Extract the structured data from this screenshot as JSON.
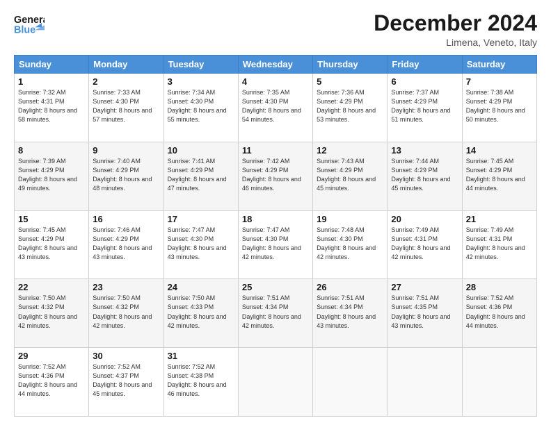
{
  "header": {
    "logo_line1": "General",
    "logo_line2": "Blue",
    "month": "December 2024",
    "location": "Limena, Veneto, Italy"
  },
  "days_of_week": [
    "Sunday",
    "Monday",
    "Tuesday",
    "Wednesday",
    "Thursday",
    "Friday",
    "Saturday"
  ],
  "weeks": [
    [
      {
        "day": 1,
        "sunrise": "7:32 AM",
        "sunset": "4:31 PM",
        "daylight": "8 hours and 58 minutes."
      },
      {
        "day": 2,
        "sunrise": "7:33 AM",
        "sunset": "4:30 PM",
        "daylight": "8 hours and 57 minutes."
      },
      {
        "day": 3,
        "sunrise": "7:34 AM",
        "sunset": "4:30 PM",
        "daylight": "8 hours and 55 minutes."
      },
      {
        "day": 4,
        "sunrise": "7:35 AM",
        "sunset": "4:30 PM",
        "daylight": "8 hours and 54 minutes."
      },
      {
        "day": 5,
        "sunrise": "7:36 AM",
        "sunset": "4:29 PM",
        "daylight": "8 hours and 53 minutes."
      },
      {
        "day": 6,
        "sunrise": "7:37 AM",
        "sunset": "4:29 PM",
        "daylight": "8 hours and 51 minutes."
      },
      {
        "day": 7,
        "sunrise": "7:38 AM",
        "sunset": "4:29 PM",
        "daylight": "8 hours and 50 minutes."
      }
    ],
    [
      {
        "day": 8,
        "sunrise": "7:39 AM",
        "sunset": "4:29 PM",
        "daylight": "8 hours and 49 minutes."
      },
      {
        "day": 9,
        "sunrise": "7:40 AM",
        "sunset": "4:29 PM",
        "daylight": "8 hours and 48 minutes."
      },
      {
        "day": 10,
        "sunrise": "7:41 AM",
        "sunset": "4:29 PM",
        "daylight": "8 hours and 47 minutes."
      },
      {
        "day": 11,
        "sunrise": "7:42 AM",
        "sunset": "4:29 PM",
        "daylight": "8 hours and 46 minutes."
      },
      {
        "day": 12,
        "sunrise": "7:43 AM",
        "sunset": "4:29 PM",
        "daylight": "8 hours and 45 minutes."
      },
      {
        "day": 13,
        "sunrise": "7:44 AM",
        "sunset": "4:29 PM",
        "daylight": "8 hours and 45 minutes."
      },
      {
        "day": 14,
        "sunrise": "7:45 AM",
        "sunset": "4:29 PM",
        "daylight": "8 hours and 44 minutes."
      }
    ],
    [
      {
        "day": 15,
        "sunrise": "7:45 AM",
        "sunset": "4:29 PM",
        "daylight": "8 hours and 43 minutes."
      },
      {
        "day": 16,
        "sunrise": "7:46 AM",
        "sunset": "4:29 PM",
        "daylight": "8 hours and 43 minutes."
      },
      {
        "day": 17,
        "sunrise": "7:47 AM",
        "sunset": "4:30 PM",
        "daylight": "8 hours and 43 minutes."
      },
      {
        "day": 18,
        "sunrise": "7:47 AM",
        "sunset": "4:30 PM",
        "daylight": "8 hours and 42 minutes."
      },
      {
        "day": 19,
        "sunrise": "7:48 AM",
        "sunset": "4:30 PM",
        "daylight": "8 hours and 42 minutes."
      },
      {
        "day": 20,
        "sunrise": "7:49 AM",
        "sunset": "4:31 PM",
        "daylight": "8 hours and 42 minutes."
      },
      {
        "day": 21,
        "sunrise": "7:49 AM",
        "sunset": "4:31 PM",
        "daylight": "8 hours and 42 minutes."
      }
    ],
    [
      {
        "day": 22,
        "sunrise": "7:50 AM",
        "sunset": "4:32 PM",
        "daylight": "8 hours and 42 minutes."
      },
      {
        "day": 23,
        "sunrise": "7:50 AM",
        "sunset": "4:32 PM",
        "daylight": "8 hours and 42 minutes."
      },
      {
        "day": 24,
        "sunrise": "7:50 AM",
        "sunset": "4:33 PM",
        "daylight": "8 hours and 42 minutes."
      },
      {
        "day": 25,
        "sunrise": "7:51 AM",
        "sunset": "4:34 PM",
        "daylight": "8 hours and 42 minutes."
      },
      {
        "day": 26,
        "sunrise": "7:51 AM",
        "sunset": "4:34 PM",
        "daylight": "8 hours and 43 minutes."
      },
      {
        "day": 27,
        "sunrise": "7:51 AM",
        "sunset": "4:35 PM",
        "daylight": "8 hours and 43 minutes."
      },
      {
        "day": 28,
        "sunrise": "7:52 AM",
        "sunset": "4:36 PM",
        "daylight": "8 hours and 44 minutes."
      }
    ],
    [
      {
        "day": 29,
        "sunrise": "7:52 AM",
        "sunset": "4:36 PM",
        "daylight": "8 hours and 44 minutes."
      },
      {
        "day": 30,
        "sunrise": "7:52 AM",
        "sunset": "4:37 PM",
        "daylight": "8 hours and 45 minutes."
      },
      {
        "day": 31,
        "sunrise": "7:52 AM",
        "sunset": "4:38 PM",
        "daylight": "8 hours and 46 minutes."
      },
      null,
      null,
      null,
      null
    ]
  ]
}
